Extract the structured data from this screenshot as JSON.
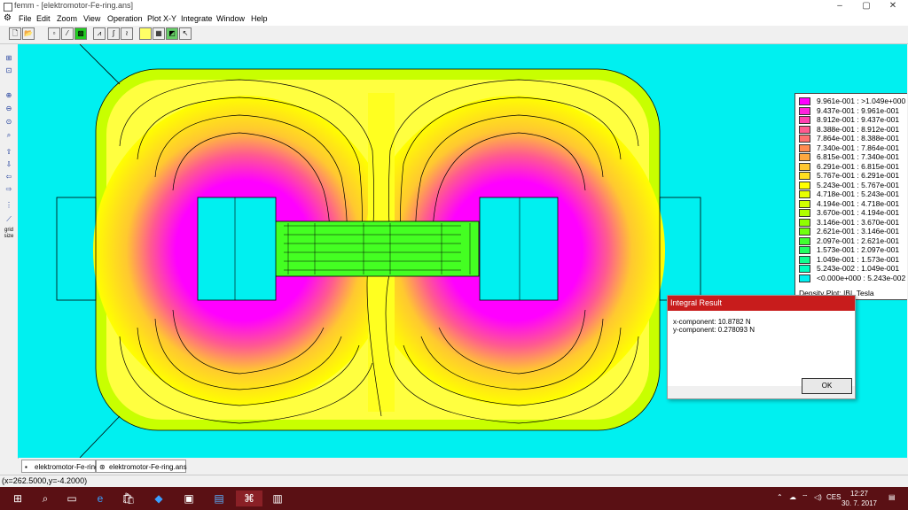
{
  "window": {
    "title": "femm - [elektromotor-Fe-ring.ans]"
  },
  "menu": [
    "File",
    "Edit",
    "Zoom",
    "View",
    "Operation",
    "Plot X-Y",
    "Integrate",
    "Window",
    "Help"
  ],
  "legend": {
    "rows": [
      {
        "label": "9.961e-001 : >1.049e+000",
        "color": "#ff00ff"
      },
      {
        "label": "9.437e-001 : 9.961e-001",
        "color": "#ff22dd"
      },
      {
        "label": "8.912e-001 : 9.437e-001",
        "color": "#ff40b0"
      },
      {
        "label": "8.388e-001 : 8.912e-001",
        "color": "#ff5a90"
      },
      {
        "label": "7.864e-001 : 8.388e-001",
        "color": "#ff7070"
      },
      {
        "label": "7.340e-001 : 7.864e-001",
        "color": "#ff8c50"
      },
      {
        "label": "6.815e-001 : 7.340e-001",
        "color": "#ffa840"
      },
      {
        "label": "6.291e-001 : 6.815e-001",
        "color": "#ffc830"
      },
      {
        "label": "5.767e-001 : 6.291e-001",
        "color": "#ffe020"
      },
      {
        "label": "5.243e-001 : 5.767e-001",
        "color": "#ffff00"
      },
      {
        "label": "4.718e-001 : 5.243e-001",
        "color": "#e8ff00"
      },
      {
        "label": "4.194e-001 : 4.718e-001",
        "color": "#d0ff00"
      },
      {
        "label": "3.670e-001 : 4.194e-001",
        "color": "#b0ff00"
      },
      {
        "label": "3.146e-001 : 3.670e-001",
        "color": "#90ff00"
      },
      {
        "label": "2.621e-001 : 3.146e-001",
        "color": "#70ff10"
      },
      {
        "label": "2.097e-001 : 2.621e-001",
        "color": "#40ff30"
      },
      {
        "label": "1.573e-001 : 2.097e-001",
        "color": "#20ff60"
      },
      {
        "label": "1.049e-001 : 1.573e-001",
        "color": "#10ff90"
      },
      {
        "label": "5.243e-002 : 1.049e-001",
        "color": "#00ffc0"
      },
      {
        "label": "<0.000e+000 : 5.243e-002",
        "color": "#00f0f0"
      }
    ],
    "caption": "Density Plot: |B|, Tesla"
  },
  "dialog": {
    "title": "Integral Result",
    "x_component": "x-component: 10.8782 N",
    "y_component": "y-component: 0.278093 N",
    "ok_label": "OK"
  },
  "tabs": [
    {
      "label": "elektromotor-Fe-ring",
      "active": false
    },
    {
      "label": "elektromotor-Fe-ring.ans",
      "active": true
    }
  ],
  "status": {
    "coords": "(x=262.5000,y=-4.2000)"
  },
  "taskbar": {
    "tray_language": "CES",
    "time": "12:27",
    "date": "30. 7. 2017"
  },
  "colors": {
    "taskbar": "#5a1014",
    "dialog_title": "#c81c1c",
    "background_field": "#00f0f0"
  }
}
